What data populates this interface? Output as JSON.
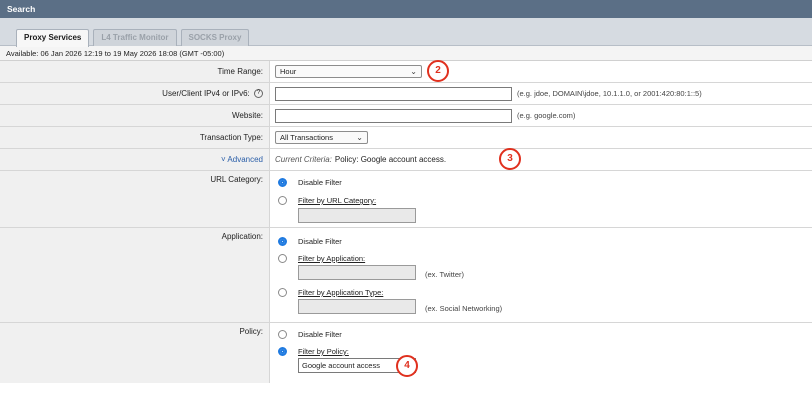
{
  "header": {
    "title": "Search"
  },
  "tabs": [
    {
      "label": "Proxy Services",
      "active": true
    },
    {
      "label": "L4 Traffic Monitor",
      "active": false
    },
    {
      "label": "SOCKS Proxy",
      "active": false
    }
  ],
  "available": "Available: 06 Jan 2026 12:19 to 19 May 2026 18:08 (GMT -05:00)",
  "time_range": {
    "label": "Time Range:",
    "value": "Hour",
    "callout": "2"
  },
  "user": {
    "label": "User/Client IPv4 or IPv6:",
    "help": "?",
    "value": "",
    "hint": "(e.g. jdoe, DOMAIN\\jdoe, 10.1.1.0, or 2001:420:80:1::5)"
  },
  "website": {
    "label": "Website:",
    "value": "",
    "hint": "(e.g. google.com)"
  },
  "transaction": {
    "label": "Transaction Type:",
    "value": "All Transactions"
  },
  "advanced": {
    "toggle": "Advanced",
    "criteria_label": "Current Criteria:",
    "criteria_value": "Policy: Google account access.",
    "callout": "3"
  },
  "url_category": {
    "label": "URL Category:",
    "opt_disable": "Disable Filter",
    "opt_filter": "Filter by URL Category:",
    "value": ""
  },
  "application": {
    "label": "Application:",
    "opt_disable": "Disable Filter",
    "opt_app": "Filter by Application:",
    "app_hint": "(ex. Twitter)",
    "opt_type": "Filter by Application Type:",
    "type_hint": "(ex. Social Networking)"
  },
  "policy": {
    "label": "Policy:",
    "opt_disable": "Disable Filter",
    "opt_filter": "Filter by Policy:",
    "value": "Google account access",
    "callout": "4"
  },
  "colors": {
    "header": "#5b6f86",
    "callout": "#e0301e",
    "radio": "#1f7ae0"
  }
}
